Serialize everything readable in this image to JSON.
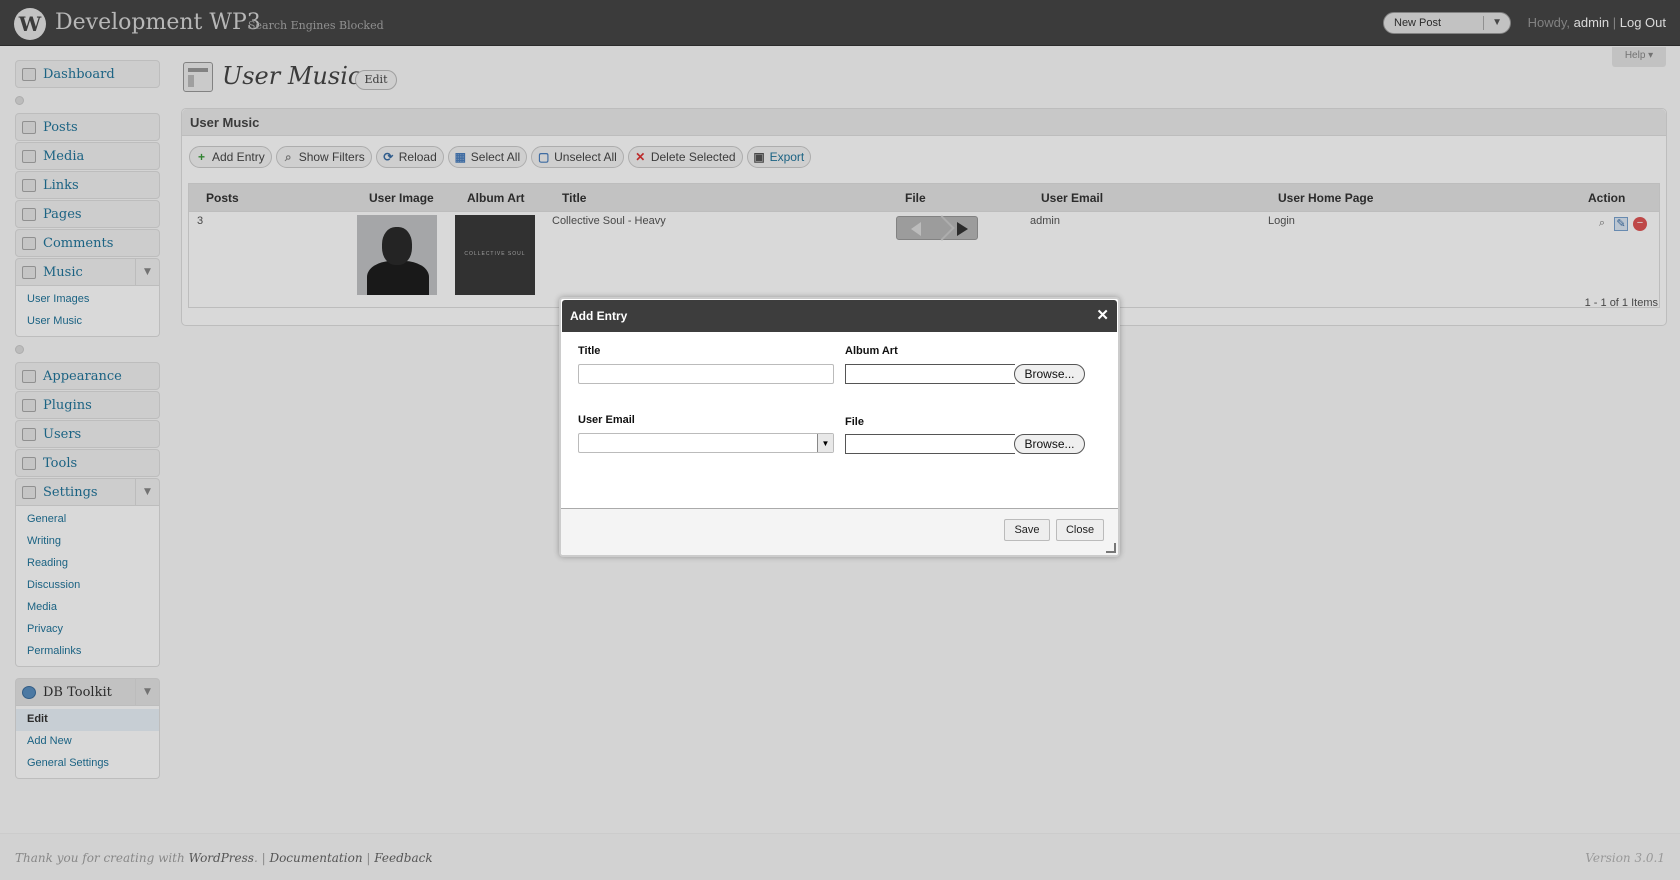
{
  "header": {
    "logo": "W",
    "site_title": "Development WP3",
    "visibility": "Search Engines Blocked",
    "new_post": "New Post",
    "howdy": "Howdy,",
    "user": "admin",
    "separator": "|",
    "logout": "Log Out"
  },
  "help": "Help ▾",
  "sidebar": {
    "dashboard": "Dashboard",
    "posts": "Posts",
    "media": "Media",
    "links": "Links",
    "pages": "Pages",
    "comments": "Comments",
    "music": "Music",
    "music_sub": [
      "User Images",
      "User Music"
    ],
    "appearance": "Appearance",
    "plugins": "Plugins",
    "users": "Users",
    "tools": "Tools",
    "settings": "Settings",
    "settings_sub": [
      "General",
      "Writing",
      "Reading",
      "Discussion",
      "Media",
      "Privacy",
      "Permalinks"
    ],
    "db_toolkit": "DB Toolkit",
    "db_toolkit_sub": [
      "Edit",
      "Add New",
      "General Settings"
    ]
  },
  "page": {
    "title": "User Music",
    "edit": "Edit"
  },
  "panel": {
    "title": "User Music",
    "toolbar": [
      "Add Entry",
      "Show Filters",
      "Reload",
      "Select All",
      "Unselect All",
      "Delete Selected",
      "Export"
    ],
    "columns": [
      "Posts",
      "User Image",
      "Album Art",
      "Title",
      "File",
      "User Email",
      "User Home Page",
      "Action"
    ],
    "row": {
      "posts": "3",
      "album_art_text": "COLLECTIVE SOUL",
      "title": "Collective Soul - Heavy",
      "user_email": "admin",
      "home_page": "Login"
    },
    "pager": "1 - 1 of 1 Items"
  },
  "dialog": {
    "title": "Add Entry",
    "close_x": "✕",
    "title_label": "Title",
    "album_art_label": "Album Art",
    "user_email_label": "User Email",
    "file_label": "File",
    "browse": "Browse...",
    "save": "Save",
    "close": "Close"
  },
  "footer": {
    "thanks": "Thank you for creating with",
    "wordpress": "WordPress",
    "documentation": "Documentation",
    "feedback": "Feedback",
    "version": "Version 3.0.1"
  }
}
